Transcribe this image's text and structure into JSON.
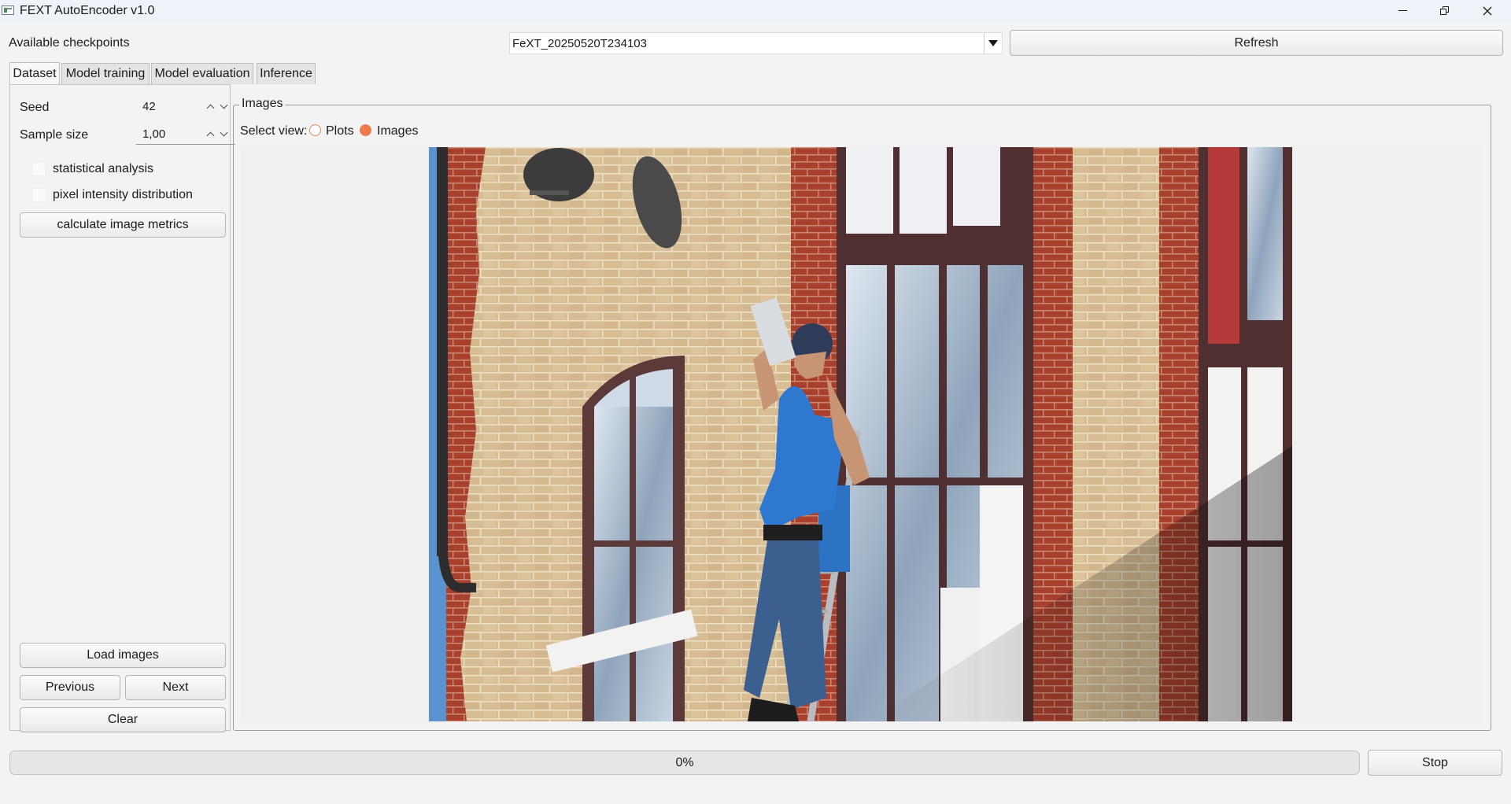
{
  "window": {
    "title": "FEXT AutoEncoder v1.0",
    "icon": "app-window-icon",
    "controls": [
      "minimize-icon",
      "restore-icon",
      "close-icon"
    ]
  },
  "checkpoints": {
    "label": "Available checkpoints",
    "selected": "FeXT_20250520T234103",
    "refresh_label": "Refresh"
  },
  "tabs": [
    {
      "label": "Dataset",
      "active": true
    },
    {
      "label": "Model training",
      "active": false
    },
    {
      "label": "Model evaluation",
      "active": false
    },
    {
      "label": "Inference",
      "active": false
    }
  ],
  "dataset_panel": {
    "seed_label": "Seed",
    "seed_value": "42",
    "sample_size_label": "Sample size",
    "sample_size_value": "1,00",
    "statistical_analysis_label": "statistical analysis",
    "statistical_analysis_checked": false,
    "pixel_intensity_label": "pixel intensity distribution",
    "pixel_intensity_checked": false,
    "calculate_metrics_label": "calculate image metrics",
    "load_images_label": "Load images",
    "previous_label": "Previous",
    "next_label": "Next",
    "clear_label": "Clear"
  },
  "images_group": {
    "title": "Images",
    "select_view_label": "Select view:",
    "options": [
      {
        "label": "Plots",
        "selected": false
      },
      {
        "label": "Images",
        "selected": true
      }
    ],
    "displayed_image": "photo of a window cleaner on a ladder against a brick building"
  },
  "status": {
    "progress_text": "0%",
    "progress_value": 0,
    "stop_label": "Stop"
  },
  "colors": {
    "accent_radio": "#ef7c4e",
    "background": "#f3f3f3",
    "titlebar": "#eef2f9"
  }
}
